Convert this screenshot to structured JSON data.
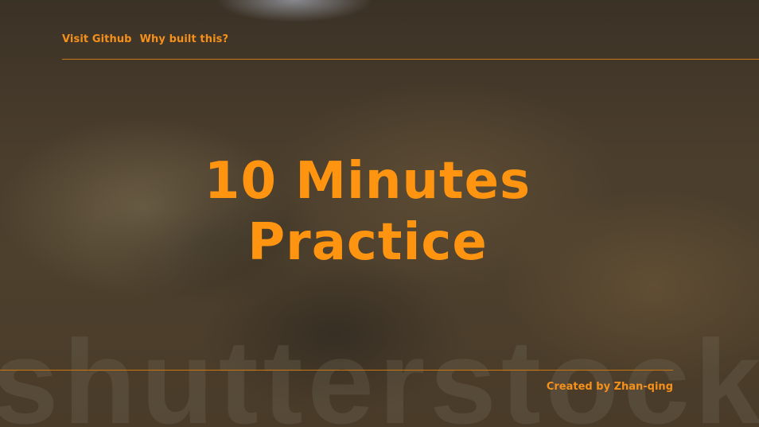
{
  "nav": {
    "links": [
      {
        "label": "Visit Github"
      },
      {
        "label": "Why built this?"
      }
    ]
  },
  "hero": {
    "title_line1": "10 Minutes",
    "title_line2": "Practice"
  },
  "footer": {
    "credit": "Created by Zhan-qing"
  },
  "background": {
    "watermark_text": "shutterstock"
  },
  "colors": {
    "accent": "#ff9410",
    "rule": "#c87512",
    "background_dark": "#3b3226"
  }
}
